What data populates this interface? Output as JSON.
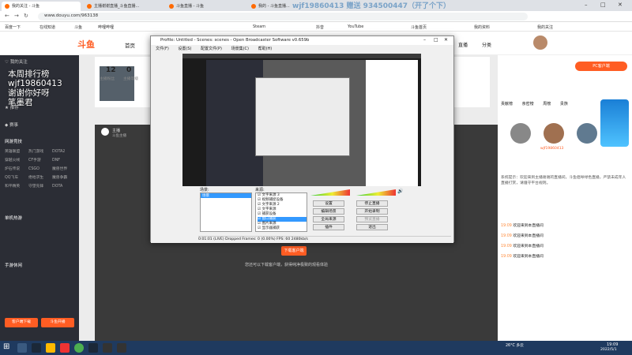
{
  "browser": {
    "tabs": [
      "我的关注 - 斗鱼",
      "主播谢谢直播_斗鱼直播...",
      "斗鱼直播 - 斗鱼",
      "我的 - 斗鱼直播..."
    ],
    "url": "www.douyu.com/963138",
    "bookmarks": [
      "百度一下",
      "在线知道",
      "斗鱼",
      "哔哩哔哩",
      "Steam",
      "抖音",
      "YouTube",
      "斗鱼首页",
      "我的资料",
      "我的关注"
    ]
  },
  "overlay_lines": [
    "本周排行榜",
    "wjf19860413",
    "谢谢你好呀",
    "笔墨君"
  ],
  "top_banner": "wjf19860413 赠送 934500447（开了个下）",
  "douyu": {
    "logo": "斗鱼",
    "nav": [
      "首页",
      "直播",
      "分类"
    ],
    "header_stats": [
      {
        "num": "12",
        "label": "主播粉丝"
      },
      {
        "num": "0",
        "label": "主播等级"
      }
    ],
    "right_buttons": [
      "下载客户端",
      "PC客户端"
    ],
    "left_sections": [
      "我的关注",
      "推荐",
      "赛事",
      "网游竞技",
      "单机热游",
      "手游休闲"
    ],
    "left_games": [
      "英雄联盟",
      "热门游戏",
      "DOTA2",
      "穿越火线",
      "CF手游",
      "DNF",
      "炉石传说",
      "CSGO",
      "魔兽世界",
      "QQ飞车",
      "绝地求生",
      "魔兽争霸",
      "和平精英",
      "守望先锋",
      "DOTA"
    ],
    "left_buttons": [
      "客户端下载",
      "斗鱼开播"
    ],
    "anchor_name": "主播",
    "anchor_sub": "斗鱼主播",
    "video_hint": "您还可以下载客户端，获得纯净极致的观看体验",
    "video_button": "下载客户端"
  },
  "rightpanel": {
    "tabs": [
      "贡献榜",
      "亲密榜",
      "周榜",
      "贵族"
    ],
    "ranks": [
      "wjf19860413",
      "用户2",
      "用户3"
    ],
    "notice": "系统提示：欢迎来到主播谢谢的直播间，斗鱼倡导绿色直播，严禁未成年人直播打赏，请遵守平台规则。",
    "chat": [
      {
        "time": "19:09",
        "text": "欢迎来到本直播间"
      },
      {
        "time": "19:09",
        "text": "欢迎来到本直播间"
      },
      {
        "time": "19:09",
        "text": "欢迎来到本直播间"
      },
      {
        "time": "19:09",
        "text": "欢迎来到本直播间"
      }
    ]
  },
  "obs": {
    "title": "Profile: Untitled - Scenes: scenes - Open Broadcaster Software v0.659b",
    "menu": [
      "文件(F)",
      "设置(S)",
      "配置文件(P)",
      "场景集(C)",
      "帮助(H)"
    ],
    "scenes_label": "场景:",
    "scenes": [
      "场景"
    ],
    "sources_label": "来源:",
    "sources": [
      "文字来源 3",
      "视频捕捉设备",
      "文字来源 2",
      "文字来源",
      "捕获设备",
      "窗口捕获",
      "图片来源",
      "显示器捕获"
    ],
    "buttons": [
      "设置",
      "停止直播",
      "编辑场景",
      "开始录制",
      "全局来源",
      "预览直播",
      "插件",
      "退出"
    ],
    "status": "0:01:01 (LIVE)  Dropped Frames: 0 (0.00%)  FPS: 60  2480kb/s"
  },
  "taskbar": {
    "weather": "26°C 多云",
    "time": "19:09",
    "date": "2022/5/1"
  }
}
